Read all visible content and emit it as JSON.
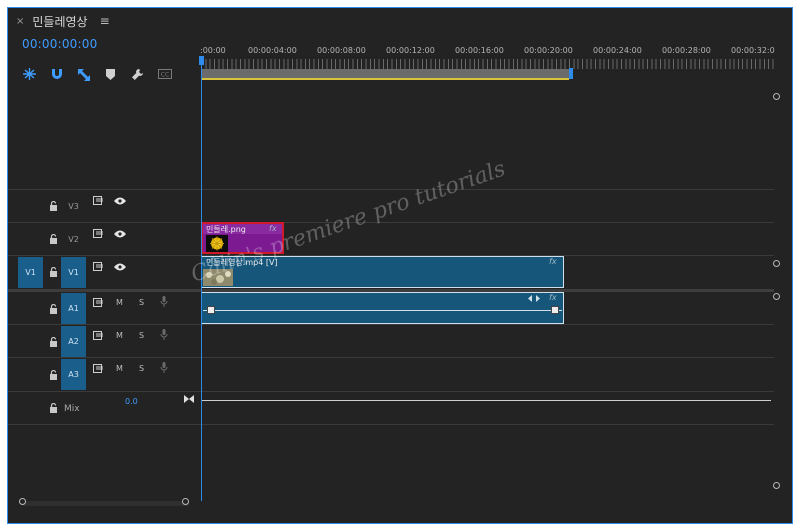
{
  "panel": {
    "close_glyph": "×",
    "title": "민들레영상",
    "menu_glyph": "≡",
    "timecode": "00:00:00:00"
  },
  "toolbar": [
    "snap-ripple-icon",
    "magnet-icon",
    "linked-selection-icon",
    "marker-icon",
    "wrench-icon",
    "captions-icon"
  ],
  "ruler": {
    "labels": [
      ":00:00",
      "00:00:04:00",
      "00:00:08:00",
      "00:00:12:00",
      "00:00:16:00",
      "00:00:20:00",
      "00:00:24:00",
      "00:00:28:00",
      "00:00:32:0"
    ]
  },
  "tracks": {
    "video": [
      {
        "id": "V3",
        "source": ""
      },
      {
        "id": "V2",
        "source": ""
      },
      {
        "id": "V1",
        "source": "V1"
      }
    ],
    "audio": [
      {
        "id": "A1",
        "mute": "M",
        "solo": "S"
      },
      {
        "id": "A2",
        "mute": "M",
        "solo": "S"
      },
      {
        "id": "A3",
        "mute": "M",
        "solo": "S"
      }
    ],
    "mix": {
      "label": "Mix",
      "value": "0.0"
    }
  },
  "clips": {
    "v2": {
      "label": "민들레.png",
      "fx": "fx"
    },
    "v1": {
      "label": "민들레영상.mp4 [V]",
      "fx": "fx"
    },
    "a1": {
      "fx": "fx"
    }
  },
  "watermark": "Câlin's premiere pro tutorials",
  "colors": {
    "accent": "#2d8ceb",
    "clip_video": "#15567a",
    "clip_image": "#7c1a92",
    "selection": "#d0192a"
  }
}
